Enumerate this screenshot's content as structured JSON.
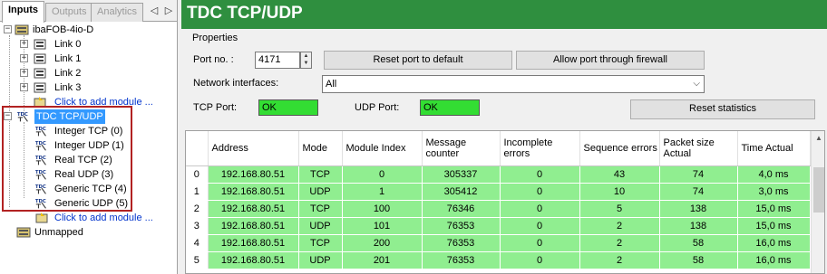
{
  "tabs": [
    {
      "label": "Inputs",
      "active": true
    },
    {
      "label": "Outputs",
      "active": false
    },
    {
      "label": "Analytics",
      "active": false
    }
  ],
  "tree": {
    "root": "ibaFOB-4io-D",
    "links": [
      "Link 0",
      "Link 1",
      "Link 2",
      "Link 3"
    ],
    "add_module_1": "Click to add module ...",
    "tdc_node": "TDC TCP/UDP",
    "tdc_icon_text": "TDC",
    "children": [
      "Integer TCP (0)",
      "Integer UDP (1)",
      "Real TCP (2)",
      "Real UDP (3)",
      "Generic TCP (4)",
      "Generic UDP (5)"
    ],
    "add_module_2": "Click to add module ...",
    "unmapped": "Unmapped"
  },
  "header": {
    "title": "TDC TCP/UDP",
    "color": "#2f8f3f"
  },
  "properties": {
    "legend": "Properties",
    "port_label": "Port no. :",
    "port_value": "4171",
    "reset_port_button": "Reset port to default",
    "firewall_button": "Allow port through firewall",
    "network_label": "Network interfaces:",
    "network_value": "All",
    "tcp_port_label": "TCP Port:",
    "tcp_port_status": "OK",
    "udp_port_label": "UDP Port:",
    "udp_port_status": "OK",
    "reset_stats_button": "Reset statistics",
    "status_ok_color": "#33dd33"
  },
  "table": {
    "headers": [
      "Address",
      "Mode",
      "Module Index",
      "Message counter",
      "Incomplete errors",
      "Sequence errors",
      "Packet size Actual",
      "Time Actual"
    ],
    "rows": [
      {
        "idx": "0",
        "cells": [
          "192.168.80.51",
          "TCP",
          "0",
          "305337",
          "0",
          "43",
          "74",
          "4,0 ms"
        ]
      },
      {
        "idx": "1",
        "cells": [
          "192.168.80.51",
          "UDP",
          "1",
          "305412",
          "0",
          "10",
          "74",
          "3,0 ms"
        ]
      },
      {
        "idx": "2",
        "cells": [
          "192.168.80.51",
          "TCP",
          "100",
          "76346",
          "0",
          "5",
          "138",
          "15,0 ms"
        ]
      },
      {
        "idx": "3",
        "cells": [
          "192.168.80.51",
          "UDP",
          "101",
          "76353",
          "0",
          "2",
          "138",
          "15,0 ms"
        ]
      },
      {
        "idx": "4",
        "cells": [
          "192.168.80.51",
          "TCP",
          "200",
          "76353",
          "0",
          "2",
          "58",
          "16,0 ms"
        ]
      },
      {
        "idx": "5",
        "cells": [
          "192.168.80.51",
          "UDP",
          "201",
          "76353",
          "0",
          "2",
          "58",
          "16,0 ms"
        ]
      }
    ],
    "row_color": "#90ee90"
  }
}
